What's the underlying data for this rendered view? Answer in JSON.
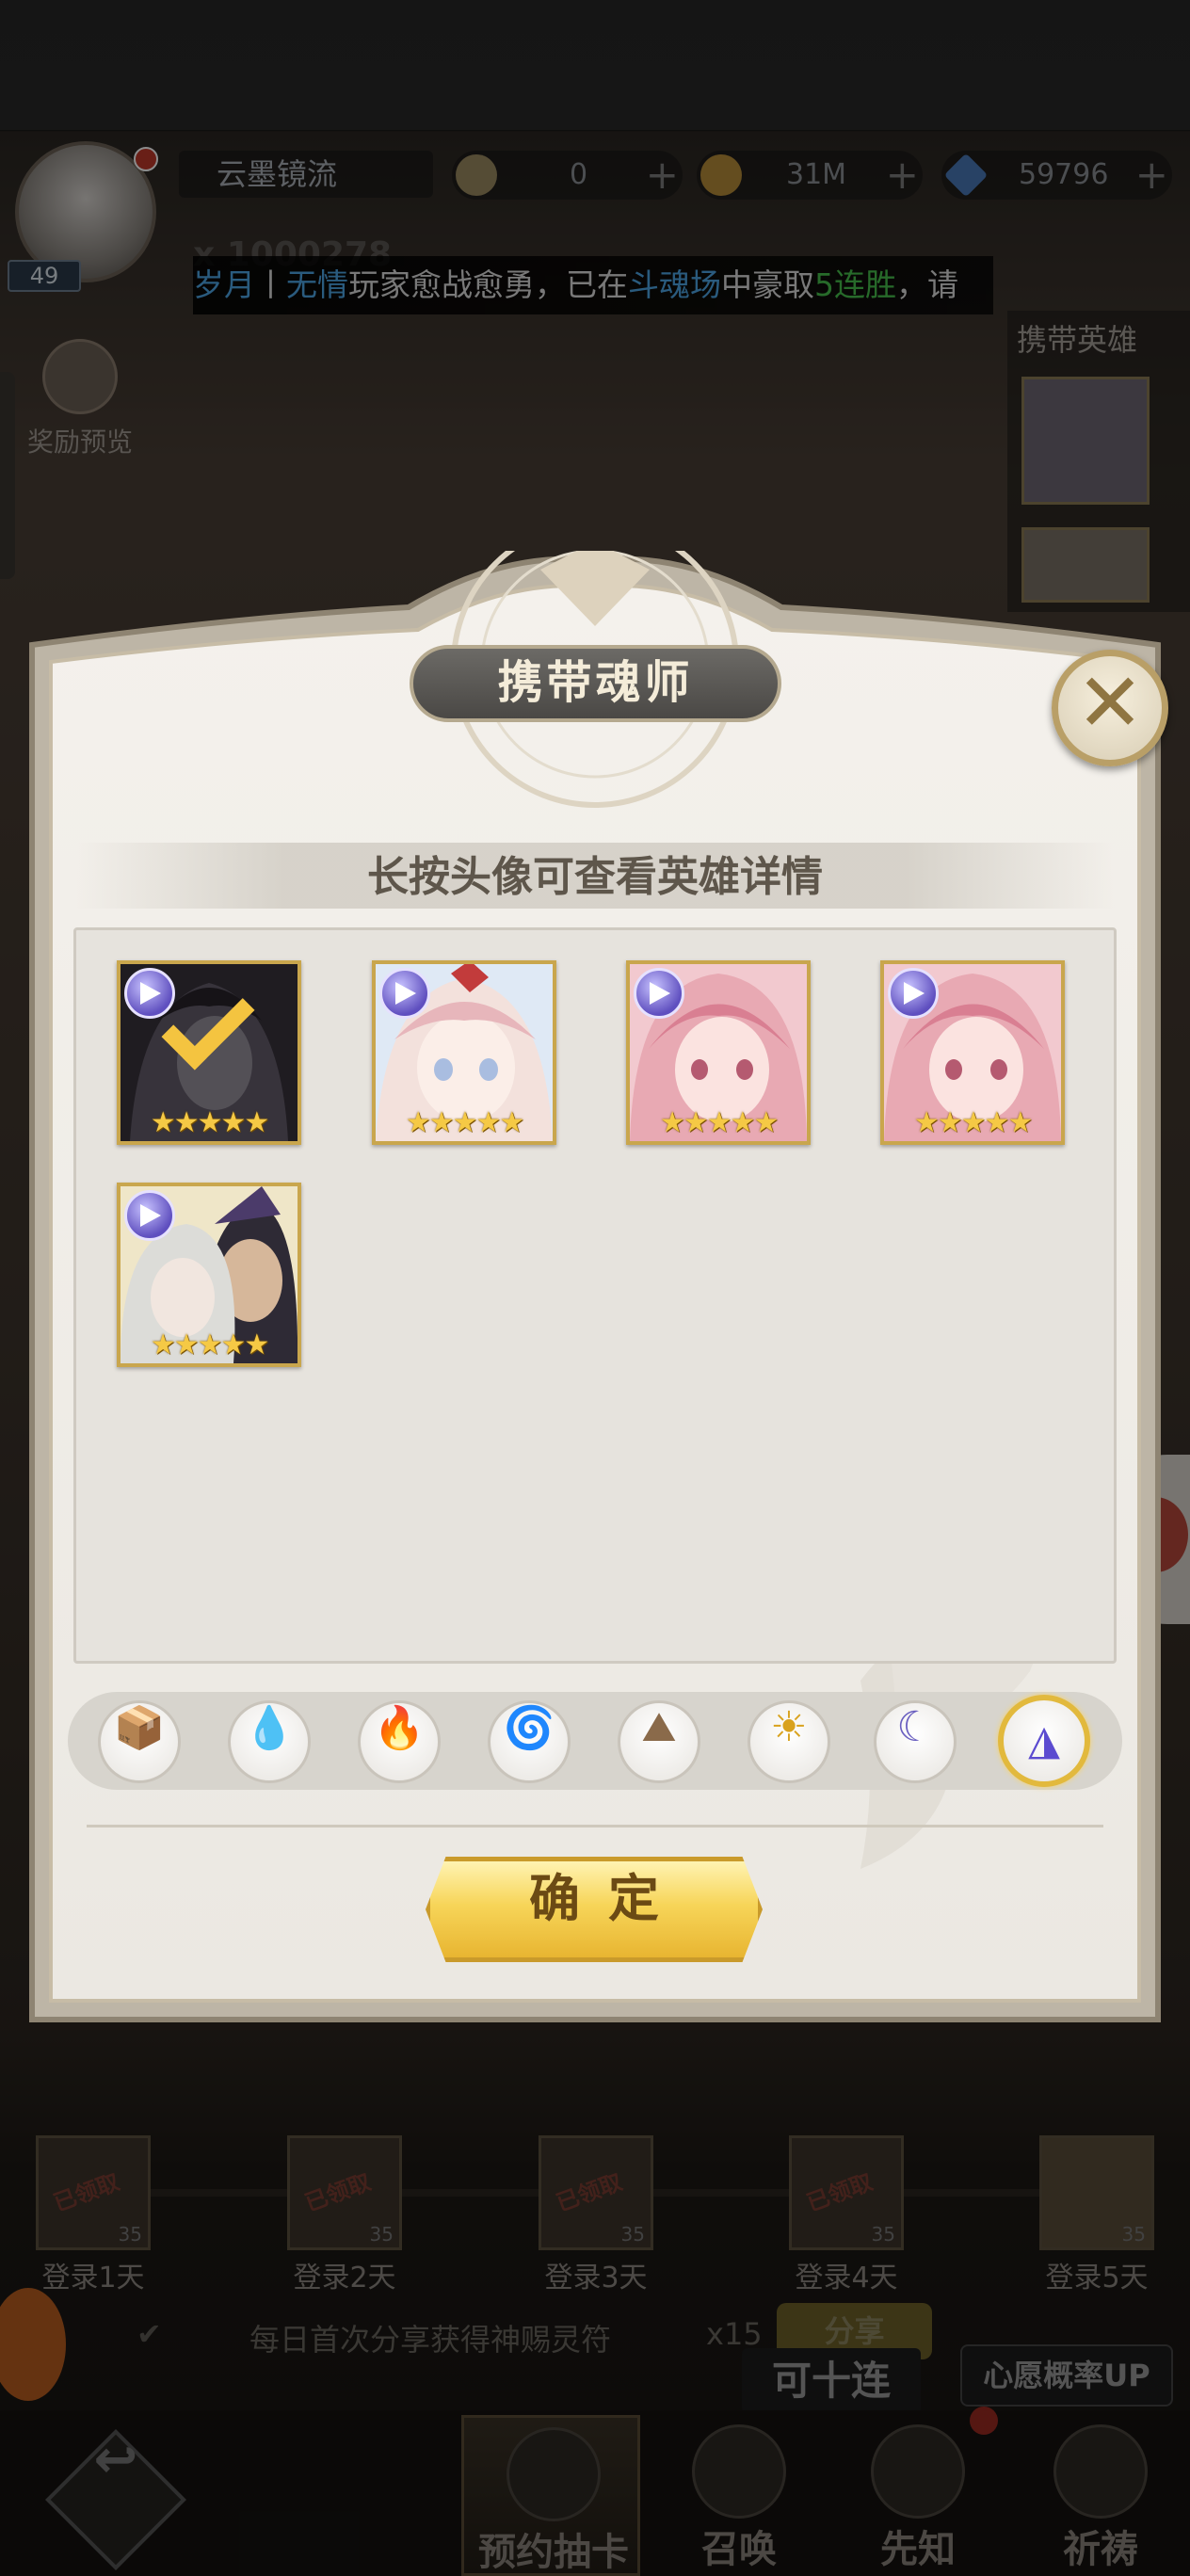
{
  "player": {
    "level": "49",
    "name": "云墨镜流",
    "ghost_id": "x 1000278"
  },
  "currencies": [
    {
      "name": "soul-coin",
      "value": "0",
      "color": "#9b8a62"
    },
    {
      "name": "gold-coin",
      "value": "31M",
      "color": "#b78d3a"
    },
    {
      "name": "diamond",
      "value": "59796",
      "color": "#4a78b8"
    }
  ],
  "ticker": {
    "player_a": "岁月",
    "sep": "丨",
    "player_b": "无情",
    "text1": "玩家愈战愈勇，已在",
    "place": "斗魂场",
    "text2": "中豪取",
    "streak": "5连胜",
    "text3": "，请"
  },
  "side": {
    "reward_preview": "奖励预览",
    "carry_heroes": "携带英雄"
  },
  "dialog": {
    "title": "携带魂师",
    "hint": "长按头像可查看英雄详情",
    "confirm": "确定",
    "close_icon": "close-icon"
  },
  "heroes": [
    {
      "name": "hero-1",
      "stars": "★★★★★",
      "selected": true,
      "palette": [
        "#3b3142",
        "#6a5a78",
        "#9b8fa6"
      ]
    },
    {
      "name": "hero-2",
      "stars": "★★★★★",
      "selected": false,
      "palette": [
        "#f3e1dc",
        "#e7b6bb",
        "#a9bde0"
      ]
    },
    {
      "name": "hero-3",
      "stars": "★★★★★",
      "selected": false,
      "palette": [
        "#e8a9b3",
        "#d97f92",
        "#b55a70"
      ]
    },
    {
      "name": "hero-4",
      "stars": "★★★★★",
      "selected": false,
      "palette": [
        "#e8a9b3",
        "#d97f92",
        "#b55a70"
      ]
    },
    {
      "name": "hero-5",
      "stars": "★★★★★",
      "selected": false,
      "palette": [
        "#dcdcd8",
        "#6b6a6e",
        "#2e2a35"
      ]
    }
  ],
  "filters": [
    {
      "name": "all",
      "icon": "box-icon",
      "glyph": "📦",
      "active": false
    },
    {
      "name": "water",
      "icon": "water-drop-icon",
      "glyph": "💧",
      "active": false
    },
    {
      "name": "fire",
      "icon": "fire-icon",
      "glyph": "🔥",
      "active": false
    },
    {
      "name": "wind",
      "icon": "whirlwind-icon",
      "glyph": "🌀",
      "active": false
    },
    {
      "name": "earth",
      "icon": "mountain-icon",
      "glyph": "⛰",
      "active": false
    },
    {
      "name": "light",
      "icon": "sun-icon",
      "glyph": "☀",
      "active": false
    },
    {
      "name": "dark",
      "icon": "moon-icon",
      "glyph": "☾",
      "active": false
    },
    {
      "name": "void",
      "icon": "arrow-prism-icon",
      "glyph": "◮",
      "active": true
    }
  ],
  "login_days": [
    {
      "label": "登录1天",
      "stamp": "已领取",
      "count": "35"
    },
    {
      "label": "登录2天",
      "stamp": "已领取",
      "count": "35"
    },
    {
      "label": "登录3天",
      "stamp": "已领取",
      "count": "35"
    },
    {
      "label": "登录4天",
      "stamp": "已领取",
      "count": "35"
    },
    {
      "label": "登录5天",
      "stamp": "",
      "count": "35"
    }
  ],
  "share": {
    "text": "每日首次分享获得神赐灵符",
    "count": "x15",
    "button": "分享"
  },
  "banners": {
    "ten_pull": "可十连",
    "wish_up": "心愿概率UP"
  },
  "nav": {
    "tabs": [
      "预约抽卡",
      "召唤",
      "先知",
      "祈祷"
    ],
    "active_tab": "预约抽卡"
  }
}
